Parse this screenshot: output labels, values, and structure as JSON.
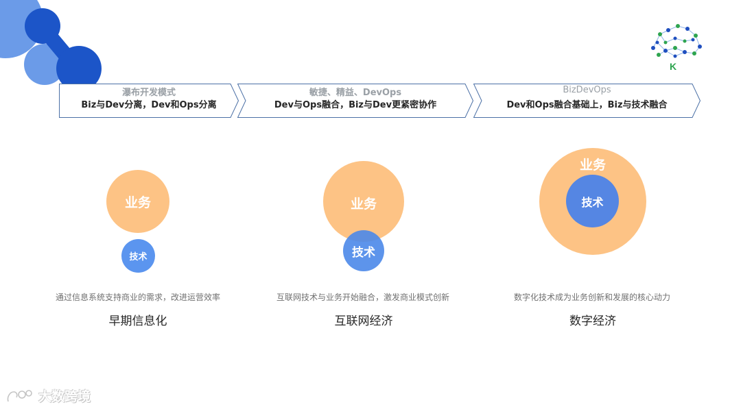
{
  "phases": [
    {
      "title": "瀑布开发模式",
      "desc": "Biz与Dev分离，Dev和Ops分离"
    },
    {
      "title": "敏捷、精益、DevOps",
      "desc": "Dev与Ops融合，Biz与Dev更紧密协作"
    },
    {
      "title": "BizDevOps",
      "desc": "Dev和Ops融合基础上，Biz与技术融合"
    }
  ],
  "stages": [
    {
      "biz_label": "业务",
      "tech_label": "技术",
      "caption": "通过信息系统支持商业的需求，改进运营效率",
      "name": "早期信息化"
    },
    {
      "biz_label": "业务",
      "tech_label": "技术",
      "caption": "互联网技术与业务开始融合，激发商业模式创新",
      "name": "互联网经济"
    },
    {
      "biz_label": "业务",
      "tech_label": "技术",
      "caption": "数字化技术成为业务创新和发展的核心动力",
      "name": "数字经济"
    }
  ],
  "logo": {
    "letter": "K"
  },
  "watermark": {
    "text": "大数跨境"
  },
  "colors": {
    "business": "#fdc385",
    "technology": "#5b95ef",
    "arrow_border": "#4a6fa5",
    "logo_green": "#2ea44f",
    "logo_blue": "#1f4fbf"
  }
}
